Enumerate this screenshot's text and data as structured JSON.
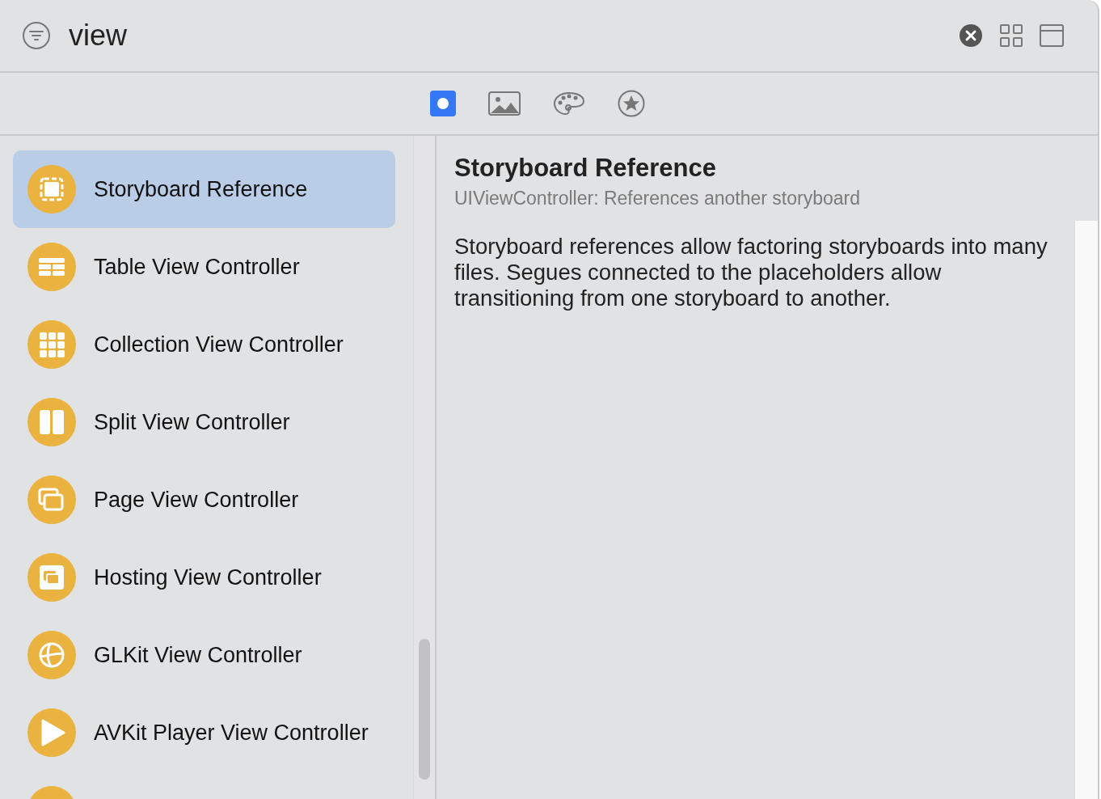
{
  "search": {
    "value": "view"
  },
  "filter_tabs": [
    {
      "kind": "objects",
      "selected": true
    },
    {
      "kind": "media",
      "selected": false
    },
    {
      "kind": "colors",
      "selected": false
    },
    {
      "kind": "favorites",
      "selected": false
    }
  ],
  "items": [
    {
      "kind": "storyboard",
      "label": "Storyboard Reference",
      "selected": true
    },
    {
      "kind": "table",
      "label": "Table View Controller",
      "selected": false
    },
    {
      "kind": "collection",
      "label": "Collection View Controller",
      "selected": false
    },
    {
      "kind": "split",
      "label": "Split View Controller",
      "selected": false
    },
    {
      "kind": "page",
      "label": "Page View Controller",
      "selected": false
    },
    {
      "kind": "hosting",
      "label": "Hosting View Controller",
      "selected": false
    },
    {
      "kind": "glkit",
      "label": "GLKit View Controller",
      "selected": false
    },
    {
      "kind": "player",
      "label": "AVKit Player View Controller",
      "selected": false
    },
    {
      "kind": "partial",
      "selected": false
    }
  ],
  "detail": {
    "title": "Storyboard Reference",
    "subtitle": "UIViewController: References another storyboard",
    "description": "Storyboard references allow factoring storyboards into many files. Segues connected to the placeholders allow transitioning from one storyboard to another."
  }
}
